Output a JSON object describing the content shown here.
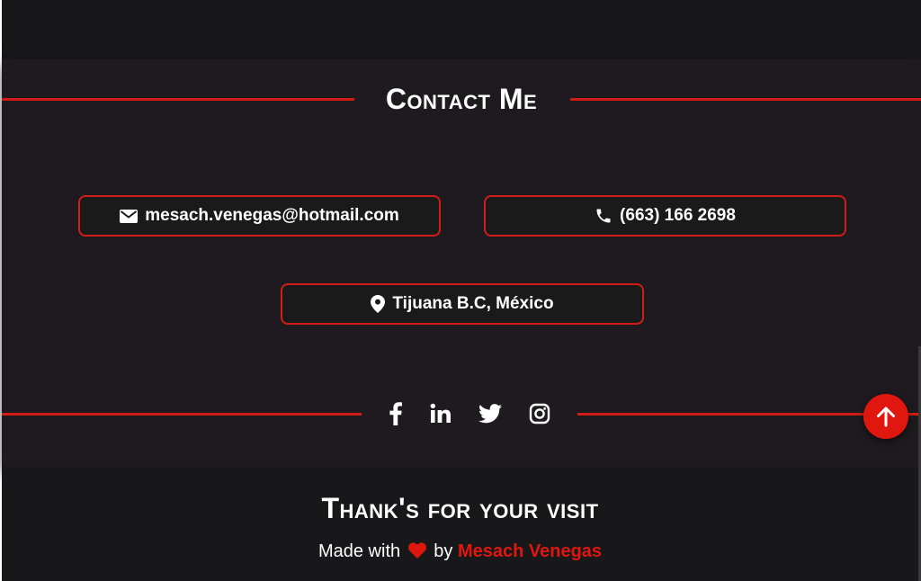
{
  "contact": {
    "title": "Contact Me",
    "email": "mesach.venegas@hotmail.com",
    "phone": "(663) 166 2698",
    "location": "Tijuana B.C, México"
  },
  "social": [
    "facebook-icon",
    "linkedin-icon",
    "twitter-icon",
    "instagram-icon"
  ],
  "footer": {
    "thanks": "Thank's for your visit",
    "made_prefix": "Made with",
    "made_by": "by",
    "author": "Mesach Venegas"
  },
  "colors": {
    "accent": "#d21d17",
    "fab": "#e0170f",
    "section_bg": "#1e1a1f",
    "page_bg": "#18181a",
    "text": "#ffffff"
  },
  "scroll_top_icon": "arrow-up-icon"
}
